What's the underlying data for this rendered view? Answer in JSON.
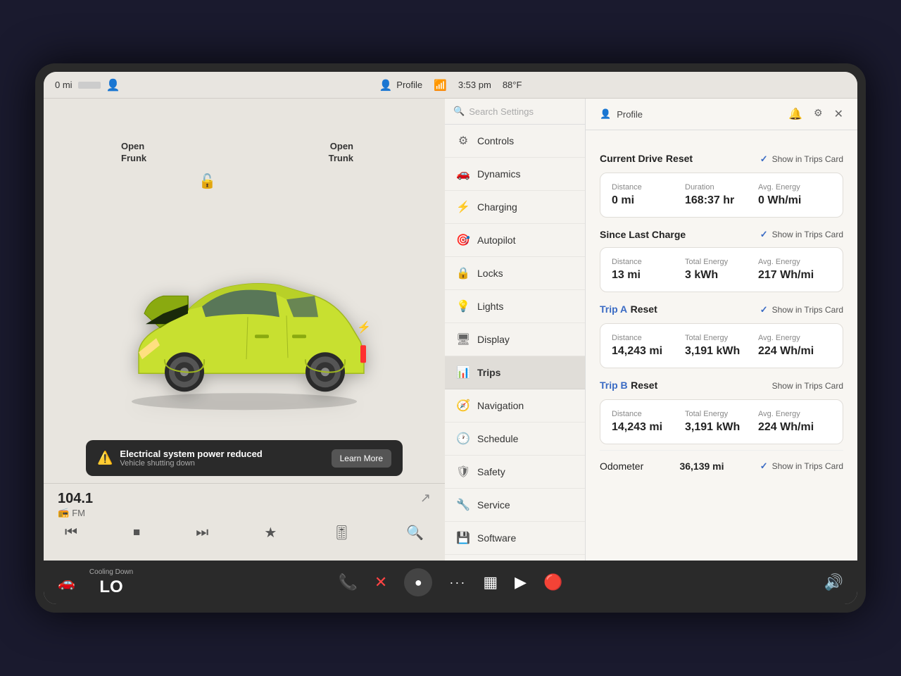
{
  "statusBar": {
    "range": "0 mi",
    "batteryIcon": "battery",
    "profileLabel": "Profile",
    "time": "3:53 pm",
    "temp": "88°F"
  },
  "leftPanel": {
    "openFrunk": "Open\nFrunk",
    "openTrunk": "Open\nTrunk",
    "alert": {
      "title": "Electrical system power reduced",
      "subtitle": "Vehicle shutting down",
      "button": "Learn More"
    }
  },
  "mediaBar": {
    "station": "104.1",
    "type": "FM",
    "typeIcon": "📻"
  },
  "menu": {
    "searchPlaceholder": "Search Settings",
    "items": [
      {
        "label": "Controls",
        "icon": "⚙",
        "active": false
      },
      {
        "label": "Dynamics",
        "icon": "🚗",
        "active": false
      },
      {
        "label": "Charging",
        "icon": "⚡",
        "active": false
      },
      {
        "label": "Autopilot",
        "icon": "🎯",
        "active": false
      },
      {
        "label": "Locks",
        "icon": "🔒",
        "active": false
      },
      {
        "label": "Lights",
        "icon": "💡",
        "active": false
      },
      {
        "label": "Display",
        "icon": "🖥",
        "active": false
      },
      {
        "label": "Trips",
        "icon": "📊",
        "active": true
      },
      {
        "label": "Navigation",
        "icon": "🧭",
        "active": false
      },
      {
        "label": "Schedule",
        "icon": "🕐",
        "active": false
      },
      {
        "label": "Safety",
        "icon": "🛡",
        "active": false
      },
      {
        "label": "Service",
        "icon": "🔧",
        "active": false
      },
      {
        "label": "Software",
        "icon": "💾",
        "active": false
      }
    ]
  },
  "tripsPanel": {
    "profileLabel": "Profile",
    "sections": {
      "currentDrive": {
        "title": "Current Drive",
        "resetLabel": "Reset",
        "showInTrips": "Show in Trips Card",
        "showChecked": true,
        "distance": {
          "label": "Distance",
          "value": "0 mi"
        },
        "duration": {
          "label": "Duration",
          "value": "168:37 hr"
        },
        "avgEnergy": {
          "label": "Avg. Energy",
          "value": "0 Wh/mi"
        }
      },
      "sinceLastCharge": {
        "title": "Since Last Charge",
        "showInTrips": "Show in Trips Card",
        "showChecked": true,
        "distance": {
          "label": "Distance",
          "value": "13 mi"
        },
        "totalEnergy": {
          "label": "Total Energy",
          "value": "3 kWh"
        },
        "avgEnergy": {
          "label": "Avg. Energy",
          "value": "217 Wh/mi"
        }
      },
      "tripA": {
        "title": "Trip A",
        "resetLabel": "Reset",
        "showInTrips": "Show in Trips Card",
        "showChecked": true,
        "distance": {
          "label": "Distance",
          "value": "14,243 mi"
        },
        "totalEnergy": {
          "label": "Total Energy",
          "value": "3,191 kWh"
        },
        "avgEnergy": {
          "label": "Avg. Energy",
          "value": "224 Wh/mi"
        }
      },
      "tripB": {
        "title": "Trip B",
        "resetLabel": "Reset",
        "showInTrips": "Show in Trips Card",
        "showChecked": false,
        "distance": {
          "label": "Distance",
          "value": "14,243 mi"
        },
        "totalEnergy": {
          "label": "Total Energy",
          "value": "3,191 kWh"
        },
        "avgEnergy": {
          "label": "Avg. Energy",
          "value": "224 Wh/mi"
        }
      },
      "odometer": {
        "label": "Odometer",
        "value": "36,139 mi",
        "showInTrips": "Show in Trips Card",
        "showChecked": true
      }
    }
  },
  "taskbar": {
    "carIcon": "🚗",
    "coolingLabel": "Cooling Down",
    "tempLabel": "LO",
    "phoneIcon": "📞",
    "toolIcon": "✕",
    "circleIcon": "●",
    "dotsIcon": "···",
    "gridIcon": "▦",
    "playIcon": "▶",
    "alertIcon": "🔴",
    "volumeIcon": "🔊"
  }
}
